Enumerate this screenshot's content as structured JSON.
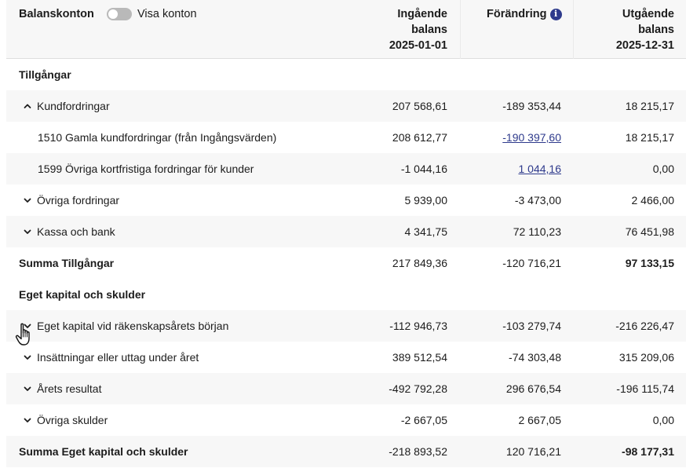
{
  "header": {
    "title": "Balanskonton",
    "toggle_label": "Visa konton",
    "col_in": [
      "Ingående",
      "balans",
      "2025-01-01"
    ],
    "col_change": "Förändring",
    "col_out": [
      "Utgående",
      "balans",
      "2025-12-31"
    ]
  },
  "rows": [
    {
      "label": "Tillgångar"
    },
    {
      "label": "Kundfordringar",
      "c1": "207 568,61",
      "c2": "-189 353,44",
      "c3": "18 215,17"
    },
    {
      "label": "1510 Gamla kundfordringar (från Ingångsvärden)",
      "c1": "208 612,77",
      "c2": "-190 397,60",
      "c3": "18 215,17"
    },
    {
      "label": "1599 Övriga kortfristiga fordringar för kunder",
      "c1": "-1 044,16",
      "c2": "1 044,16",
      "c3": "0,00"
    },
    {
      "label": "Övriga fordringar",
      "c1": "5 939,00",
      "c2": "-3 473,00",
      "c3": "2 466,00"
    },
    {
      "label": "Kassa och bank",
      "c1": "4 341,75",
      "c2": "72 110,23",
      "c3": "76 451,98"
    },
    {
      "label": "Summa Tillgångar",
      "c1": "217 849,36",
      "c2": "-120 716,21",
      "c3": "97 133,15"
    },
    {
      "label": "Eget kapital och skulder"
    },
    {
      "label": "Eget kapital vid räkenskapsårets början",
      "c1": "-112 946,73",
      "c2": "-103 279,74",
      "c3": "-216 226,47"
    },
    {
      "label": "Insättningar eller uttag under året",
      "c1": "389 512,54",
      "c2": "-74 303,48",
      "c3": "315 209,06"
    },
    {
      "label": "Årets resultat",
      "c1": "-492 792,28",
      "c2": "296 676,54",
      "c3": "-196 115,74"
    },
    {
      "label": "Övriga skulder",
      "c1": "-2 667,05",
      "c2": "2 667,05",
      "c3": "0,00"
    },
    {
      "label": "Summa Eget kapital och skulder",
      "c1": "-218 893,52",
      "c2": "120 716,21",
      "c3": "-98 177,31"
    }
  ],
  "icons": {
    "expanded": "chevron-up-icon",
    "collapsed": "chevron-down-icon",
    "info": "info-icon",
    "cursor": "hand-pointer-icon"
  },
  "colors": {
    "accent": "#2e3a8c",
    "row_shade": "#f7f7f7",
    "toggle_off": "#b9b9b9"
  }
}
